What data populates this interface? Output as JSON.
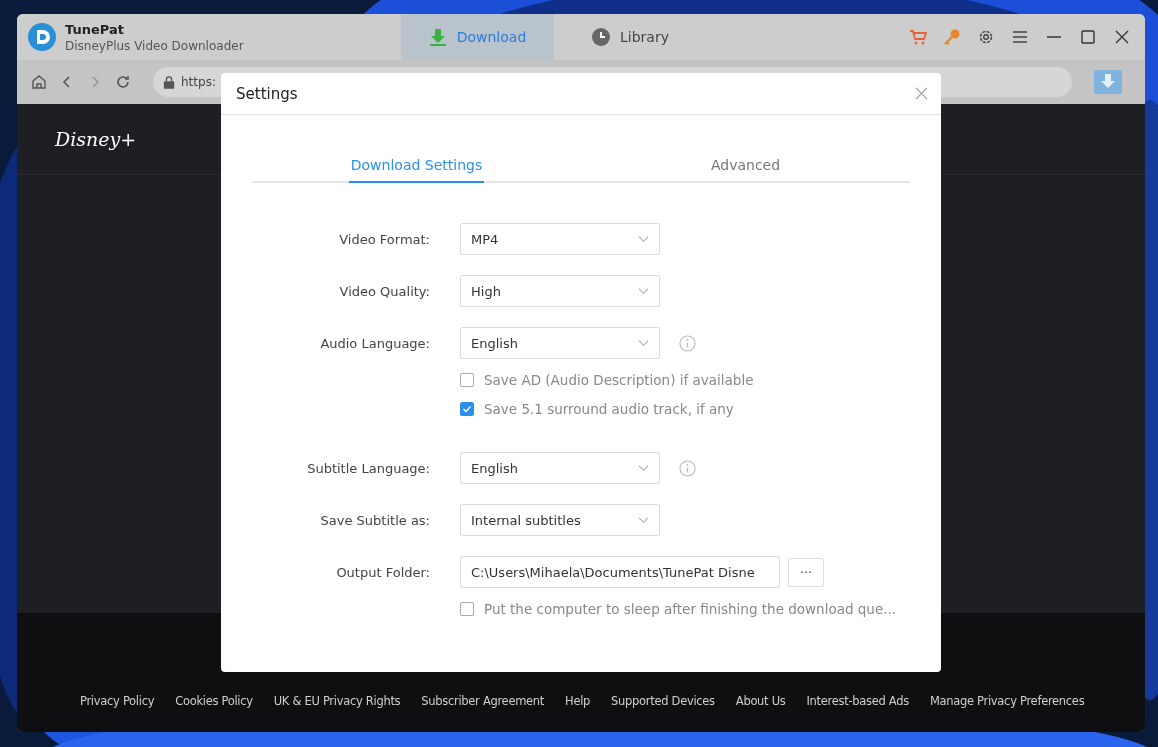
{
  "app": {
    "name": "TunePat",
    "subtitle": "DisneyPlus Video Downloader"
  },
  "tabs": [
    {
      "label": "Download",
      "selected": true,
      "kind": "download"
    },
    {
      "label": "Library",
      "selected": false,
      "kind": "library"
    }
  ],
  "address_bar": {
    "value": "https:"
  },
  "page": {
    "logo": "Disney+",
    "footer_links": [
      "Privacy Policy",
      "Cookies Policy",
      "UK & EU Privacy Rights",
      "Subscriber Agreement",
      "Help",
      "Supported Devices",
      "About Us",
      "Interest-based Ads",
      "Manage Privacy Preferences"
    ]
  },
  "dialog": {
    "title": "Settings",
    "tabs": [
      {
        "label": "Download Settings",
        "selected": true
      },
      {
        "label": "Advanced",
        "selected": false
      }
    ],
    "rows": [
      {
        "kind": "select",
        "label": "Video Format:",
        "value": "MP4",
        "info": false
      },
      {
        "kind": "select",
        "label": "Video Quality:",
        "value": "High",
        "info": false
      },
      {
        "kind": "select",
        "label": "Audio Language:",
        "value": "English",
        "info": true
      },
      {
        "kind": "checkbox",
        "label": "Save AD (Audio Description) if available",
        "checked": false
      },
      {
        "kind": "checkbox",
        "label": "Save 5.1 surround audio track, if any",
        "checked": true
      },
      {
        "kind": "select",
        "label": "Subtitle Language:",
        "value": "English",
        "info": true
      },
      {
        "kind": "select",
        "label": "Save Subtitle as:",
        "value": "Internal subtitles",
        "info": false
      },
      {
        "kind": "folder",
        "label": "Output Folder:",
        "value": "C:\\Users\\Mihaela\\Documents\\TunePat Disne",
        "button": "···"
      },
      {
        "kind": "checkbox",
        "label": "Put the computer to sleep after finishing the download que...",
        "checked": false
      }
    ]
  }
}
